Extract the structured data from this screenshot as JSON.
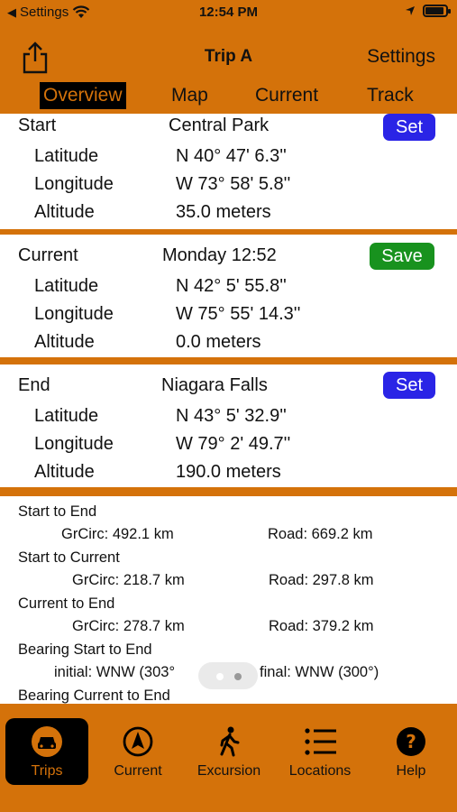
{
  "status_bar": {
    "back_label": "Settings",
    "time": "12:54 PM"
  },
  "nav": {
    "title": "Trip A",
    "settings_label": "Settings"
  },
  "segments": [
    "Overview",
    "Map",
    "Current",
    "Track"
  ],
  "start": {
    "label": "Start",
    "name": "Central Park",
    "button": "Set",
    "latitude_label": "Latitude",
    "latitude": "N 40° 47' 6.3''",
    "longitude_label": "Longitude",
    "longitude": "W 73° 58' 5.8''",
    "altitude_label": "Altitude",
    "altitude": "35.0 meters"
  },
  "current": {
    "label": "Current",
    "name": "Monday  12:52",
    "button": "Save",
    "latitude_label": "Latitude",
    "latitude": "N 42° 5' 55.8''",
    "longitude_label": "Longitude",
    "longitude": "W 75° 55' 14.3''",
    "altitude_label": "Altitude",
    "altitude": "0.0 meters"
  },
  "end": {
    "label": "End",
    "name": "Niagara Falls",
    "button": "Set",
    "latitude_label": "Latitude",
    "latitude": "N 43° 5' 32.9''",
    "longitude_label": "Longitude",
    "longitude": "W 79° 2' 49.7''",
    "altitude_label": "Altitude",
    "altitude": "190.0 meters"
  },
  "summary": {
    "start_to_end": {
      "label": "Start to End",
      "grcirc": "GrCirc: 492.1 km",
      "road": "Road: 669.2 km"
    },
    "start_to_current": {
      "label": "Start to Current",
      "grcirc": "GrCirc: 218.7 km",
      "road": "Road: 297.8 km"
    },
    "current_to_end": {
      "label": "Current to End",
      "grcirc": "GrCirc: 278.7 km",
      "road": "Road: 379.2 km"
    },
    "bearing_start_end": {
      "label": "Bearing Start to End",
      "initial": "initial:  WNW (303°",
      "final": "final:  WNW (300°)"
    },
    "bearing_current_end": {
      "label": "Bearing Current to End"
    }
  },
  "tabs": [
    "Trips",
    "Current",
    "Excursion",
    "Locations",
    "Help"
  ],
  "colors": {
    "orange": "#d4720a",
    "set_blue": "#2a24e6",
    "save_green": "#18921e"
  }
}
